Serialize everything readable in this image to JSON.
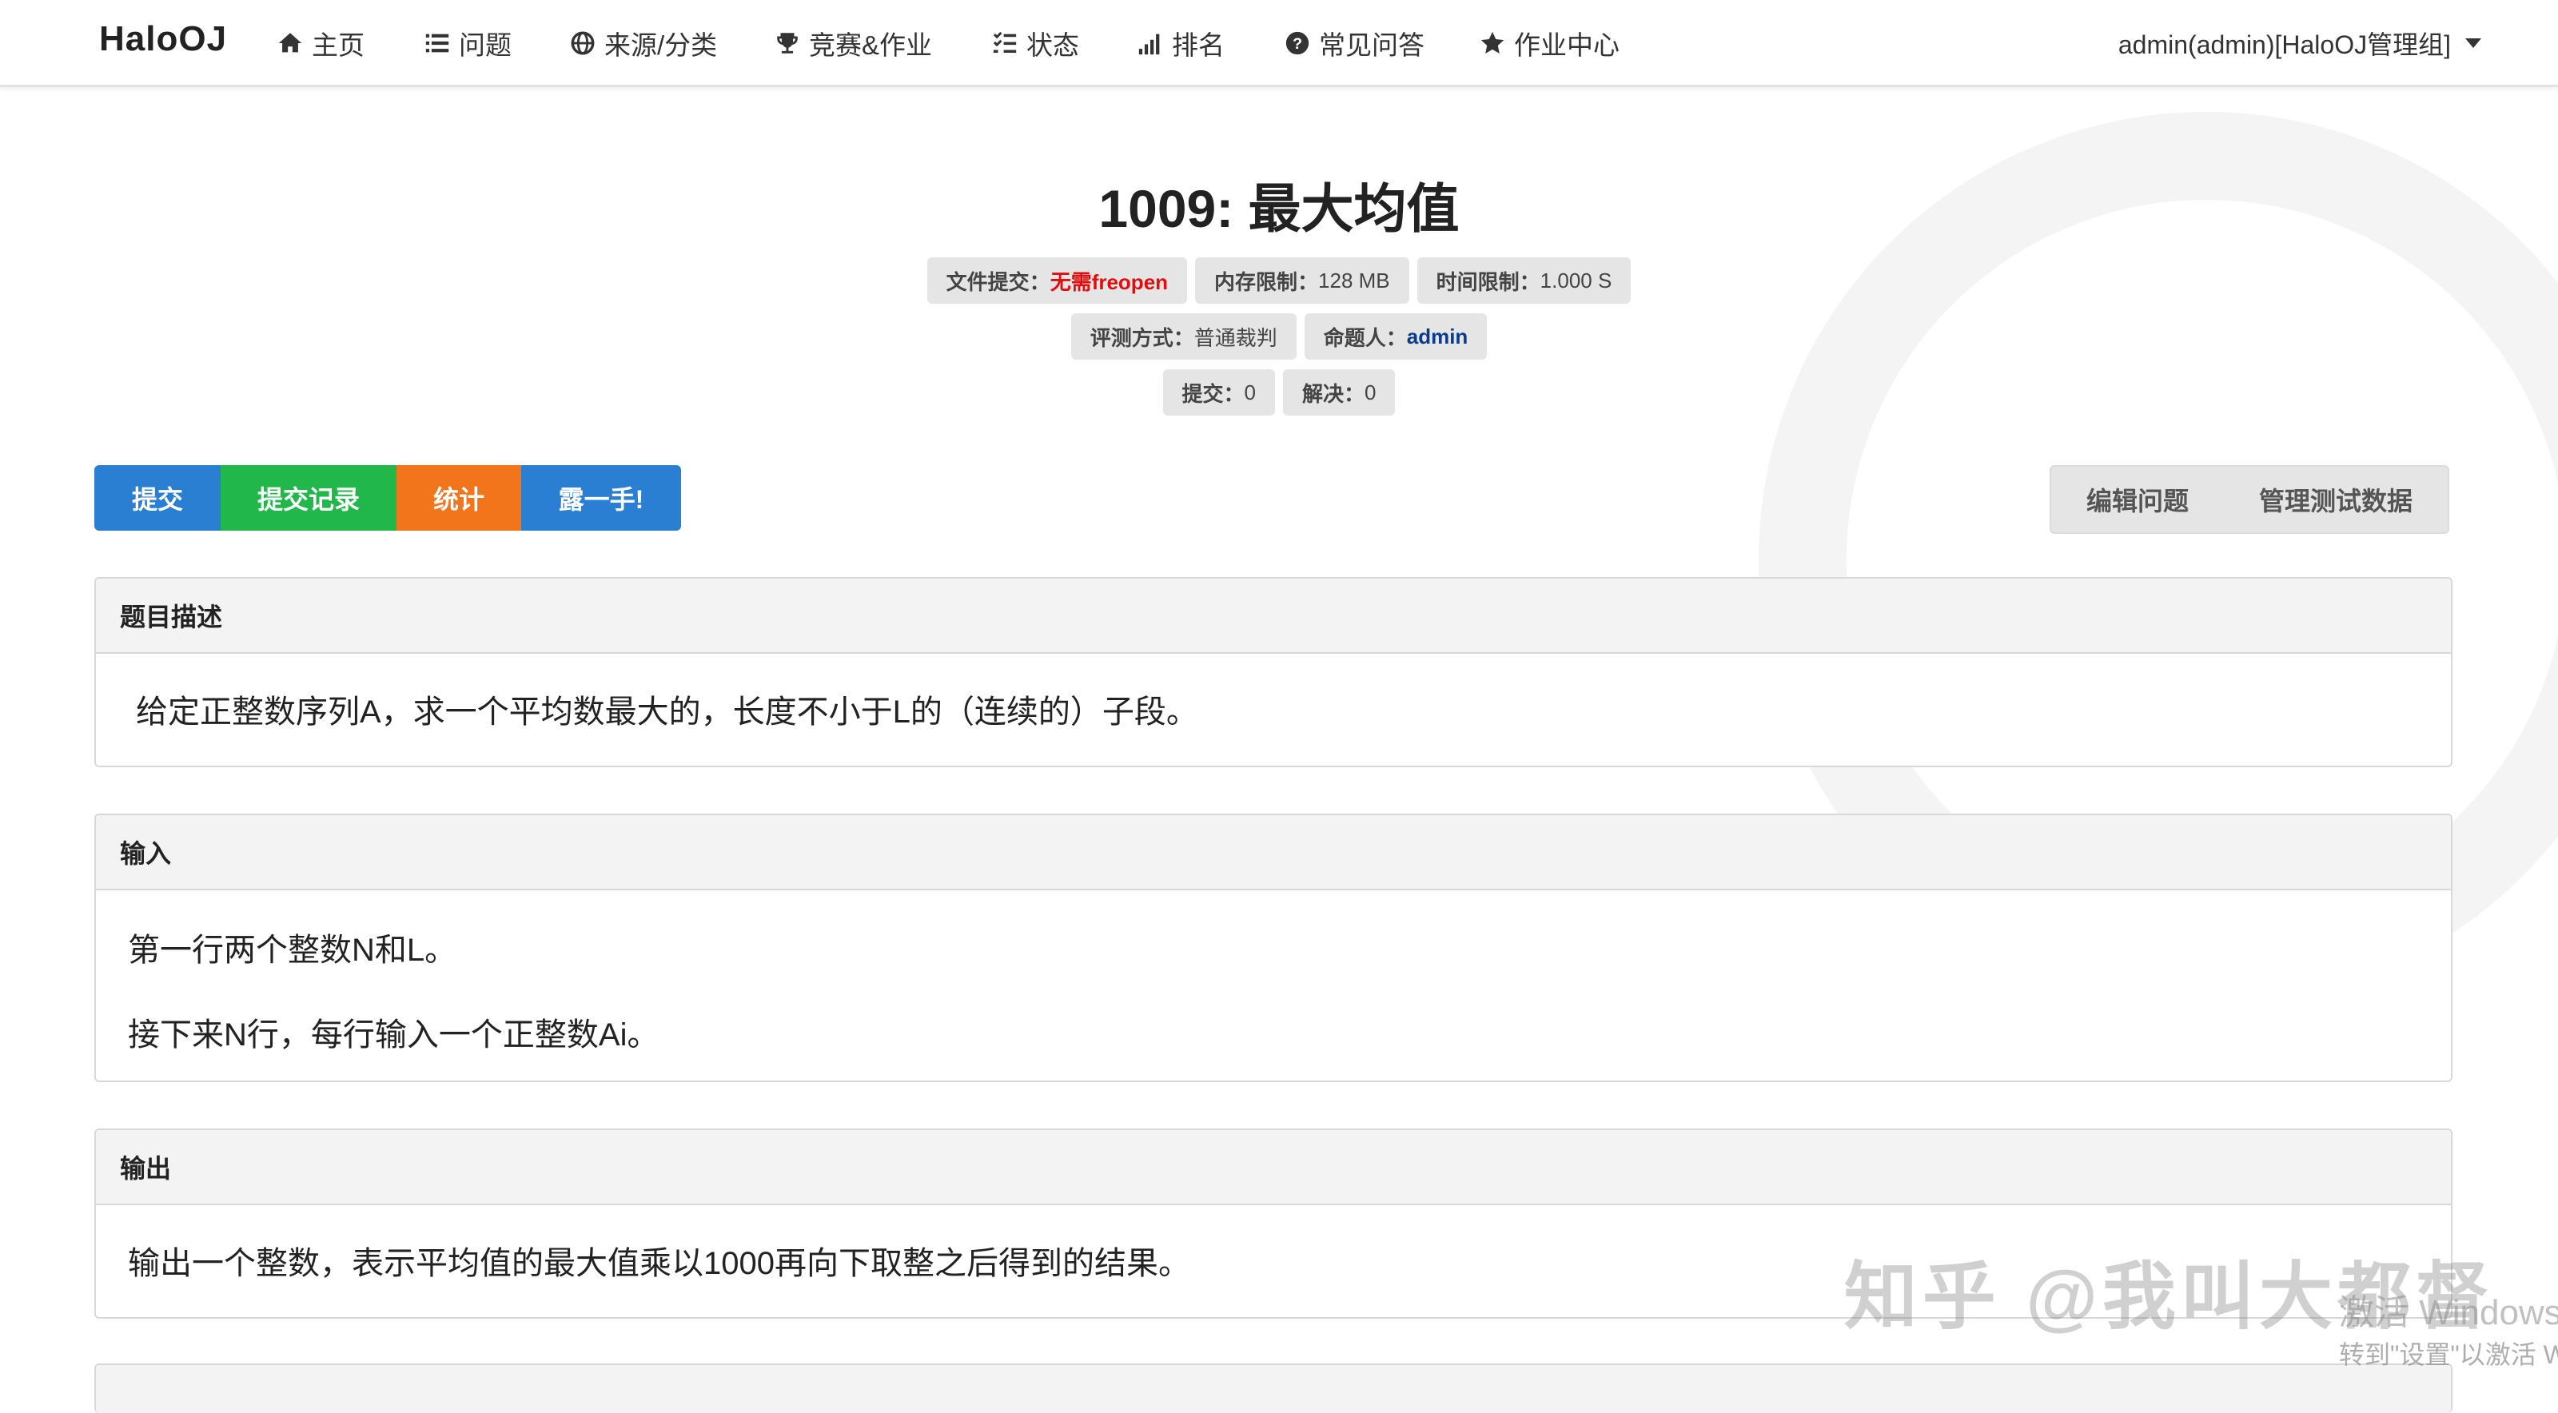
{
  "nav": {
    "brand": "HaloOJ",
    "items": [
      {
        "label": "主页",
        "icon": "home-icon"
      },
      {
        "label": "问题",
        "icon": "list-icon"
      },
      {
        "label": "来源/分类",
        "icon": "globe-icon"
      },
      {
        "label": "竞赛&作业",
        "icon": "trophy-icon"
      },
      {
        "label": "状态",
        "icon": "tasks-icon"
      },
      {
        "label": "排名",
        "icon": "signal-icon"
      },
      {
        "label": "常见问答",
        "icon": "question-circle-icon"
      },
      {
        "label": "作业中心",
        "icon": "star-icon"
      }
    ],
    "user": "admin(admin)[HaloOJ管理组]"
  },
  "problem": {
    "title": "1009: 最大均值",
    "meta": {
      "file_submit_label": "文件提交：",
      "file_submit_value": "无需freopen",
      "memory_label": "内存限制：",
      "memory_value": "128 MB",
      "time_label": "时间限制：",
      "time_value": "1.000 S",
      "judge_label": "评测方式：",
      "judge_value": "普通裁判",
      "author_label": "命题人：",
      "author_value": "admin",
      "submit_label": "提交：",
      "submit_value": "0",
      "solved_label": "解决：",
      "solved_value": "0"
    }
  },
  "actions": {
    "submit": "提交",
    "records": "提交记录",
    "stats": "统计",
    "show": "露一手!",
    "edit": "编辑问题",
    "manage_data": "管理测试数据"
  },
  "sections": {
    "desc_title": "题目描述",
    "desc_text": "给定正整数序列A，求一个平均数最大的，长度不小于L的（连续的）子段。",
    "input_title": "输入",
    "input_line1": "第一行两个整数N和L。",
    "input_line2": "接下来N行，每行输入一个正整数Ai。",
    "output_title": "输出",
    "output_text": "输出一个整数，表示平均值的最大值乘以1000再向下取整之后得到的结果。"
  },
  "overlay": {
    "watermark": "知乎 @我叫大都督",
    "activate_line1": "激活 Windows",
    "activate_line2": "转到\"设置\"以激活 Windows。"
  },
  "colors": {
    "primary": "#2a7fd3",
    "success": "#21b74b",
    "warning": "#f2741b",
    "danger_text": "#e20e0e",
    "link_text": "#0b3b8c"
  }
}
